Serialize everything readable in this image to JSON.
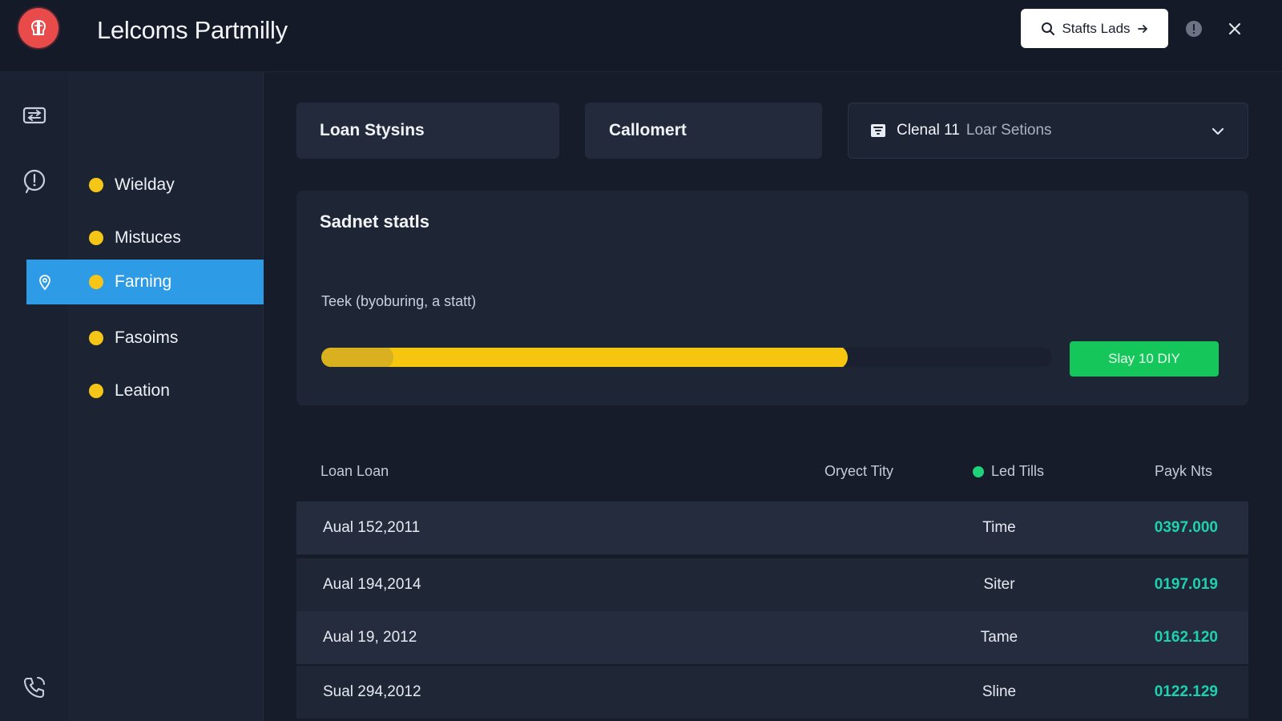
{
  "header": {
    "title": "Lelcoms Partmilly",
    "start_button": "Stafts Lads",
    "accent": "#e94a4a"
  },
  "rail": {
    "icons": [
      "transfer-icon",
      "clock-alert-icon",
      "phone-history-icon"
    ]
  },
  "nav": {
    "items": [
      {
        "label": "Wielday",
        "active": false
      },
      {
        "label": "Mistuces",
        "active": false
      },
      {
        "label": "Farning",
        "active": true
      },
      {
        "label": "Fasoims",
        "active": false
      },
      {
        "label": "Leation",
        "active": false
      }
    ],
    "active_color": "#2e9be6",
    "dot_color": "#f5c518"
  },
  "tabs": [
    {
      "label": "Loan Stysins"
    },
    {
      "label": "Callomert"
    }
  ],
  "dropdown": {
    "strong": "Clenal 11",
    "value": "Loar Setions"
  },
  "status": {
    "title": "Sadnet statls",
    "subtitle": "Teek (byoburing, a statt)",
    "progress_percent": 72,
    "action_label": "Slay 10 DIY",
    "bar_color": "#f5c50f",
    "action_color": "#15c75a"
  },
  "table": {
    "headers": [
      "Loan Loan",
      "Oryect Tity",
      "Led Tills",
      "Payk Nts"
    ],
    "rows": [
      {
        "date": "Aual 152,2011",
        "type": "Time",
        "amount": "0397.000"
      },
      {
        "date": "Aual 194,2014",
        "type": "Siter",
        "amount": "0197.019"
      },
      {
        "date": "Aual 19, 2012",
        "type": "Tame",
        "amount": "0162.120"
      },
      {
        "date": "Sual 294,2012",
        "type": "Sline",
        "amount": "0122.129"
      }
    ]
  }
}
